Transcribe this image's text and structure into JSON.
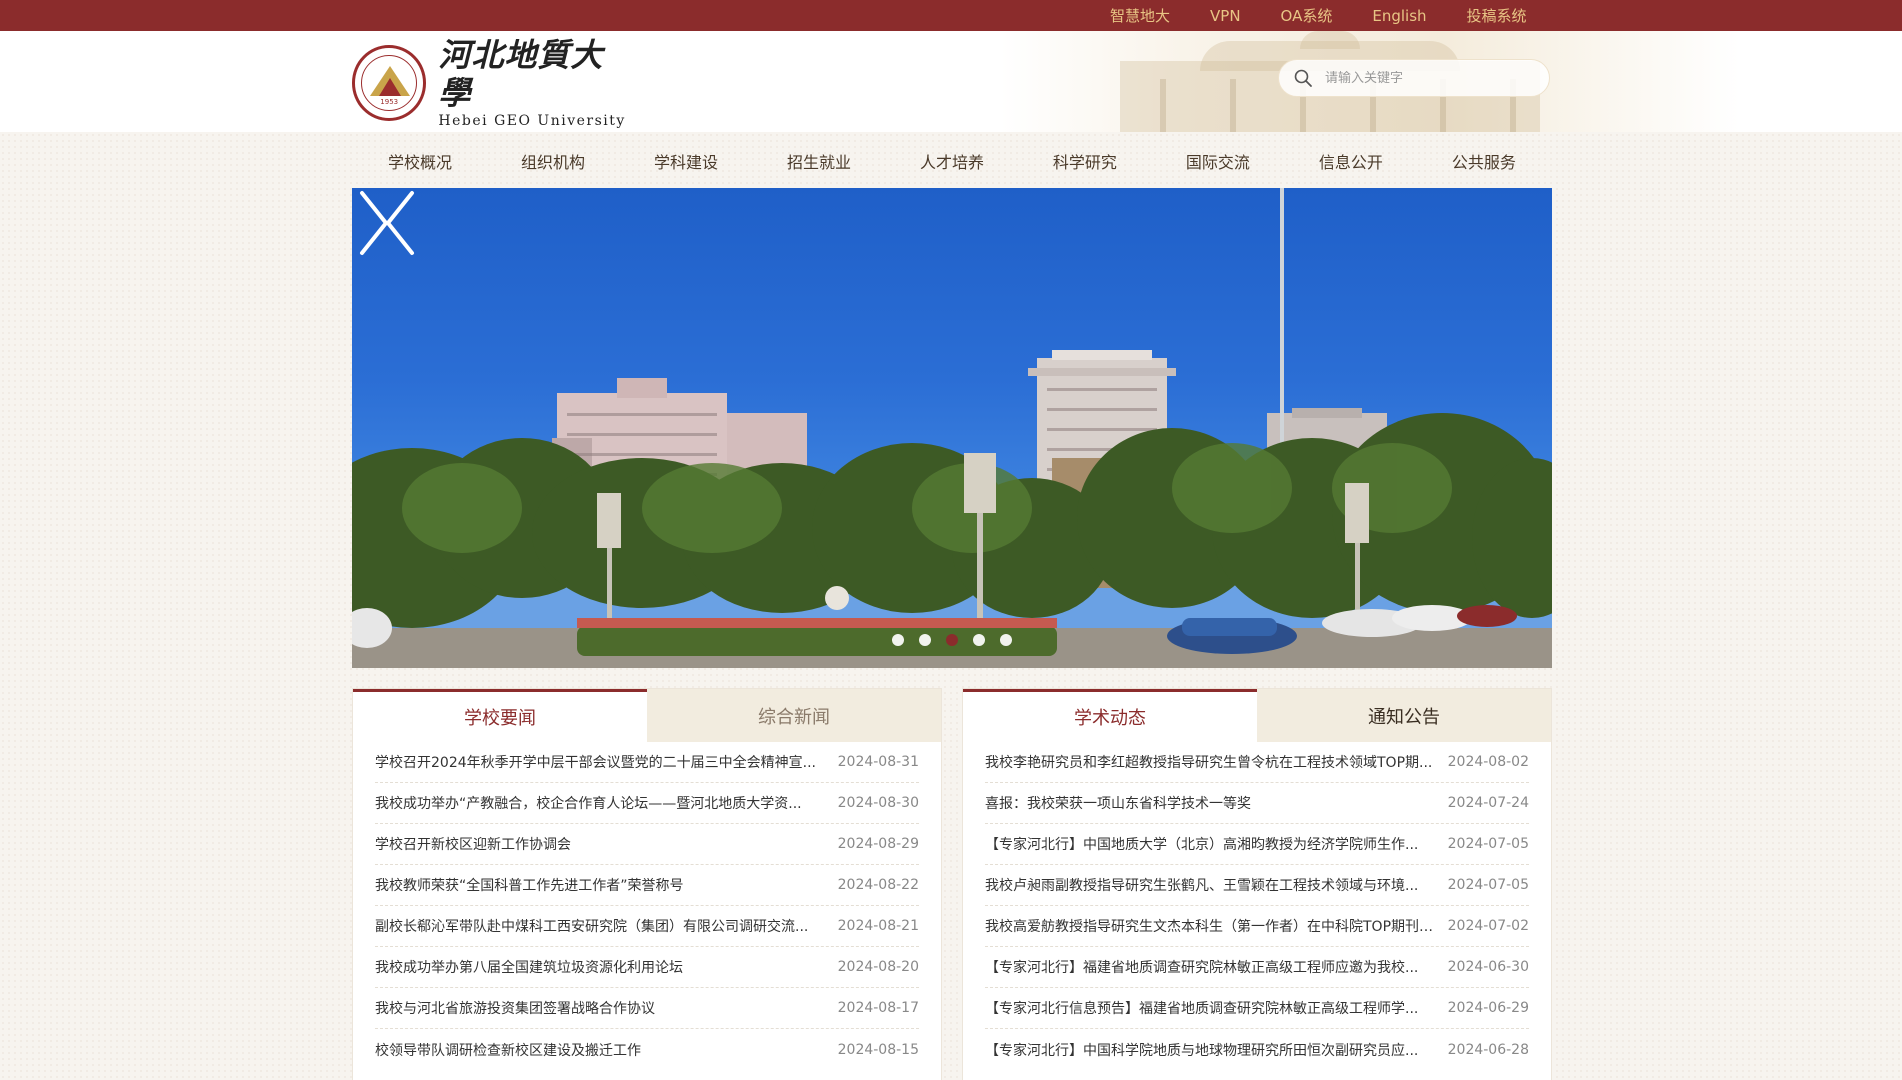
{
  "topbar": {
    "links": [
      "智慧地大",
      "VPN",
      "OA系统",
      "English",
      "投稿系统"
    ]
  },
  "header": {
    "logo_cn": "河北地質大學",
    "logo_en": "Hebei GEO University",
    "seal_year": "1953",
    "search_placeholder": "请输入关键字"
  },
  "nav": {
    "items": [
      "学校概况",
      "组织机构",
      "学科建设",
      "招生就业",
      "人才培养",
      "科学研究",
      "国际交流",
      "信息公开",
      "公共服务"
    ]
  },
  "banner": {
    "slide_count": 5,
    "active_slide": 3
  },
  "left_panel": {
    "tabs": [
      "学校要闻",
      "综合新闻"
    ],
    "active_tab": 0,
    "items": [
      {
        "title": "学校召开2024年秋季开学中层干部会议暨党的二十届三中全会精神宣...",
        "date": "2024-08-31"
      },
      {
        "title": "我校成功举办“产教融合，校企合作育人论坛——暨河北地质大学资...",
        "date": "2024-08-30"
      },
      {
        "title": "学校召开新校区迎新工作协调会",
        "date": "2024-08-29"
      },
      {
        "title": "我校教师荣获“全国科普工作先进工作者”荣誉称号",
        "date": "2024-08-22"
      },
      {
        "title": "副校长郗沁军带队赴中煤科工西安研究院（集团）有限公司调研交流...",
        "date": "2024-08-21"
      },
      {
        "title": "我校成功举办第八届全国建筑垃圾资源化利用论坛",
        "date": "2024-08-20"
      },
      {
        "title": "我校与河北省旅游投资集团签署战略合作协议",
        "date": "2024-08-17"
      },
      {
        "title": "校领导带队调研检查新校区建设及搬迁工作",
        "date": "2024-08-15"
      }
    ]
  },
  "right_panel": {
    "tabs": [
      "学术动态",
      "通知公告"
    ],
    "active_tab": 0,
    "items": [
      {
        "title": "我校李艳研究员和李红超教授指导研究生曾令杭在工程技术领域TOP期...",
        "date": "2024-08-02"
      },
      {
        "title": "喜报：我校荣获一项山东省科学技术一等奖",
        "date": "2024-07-24"
      },
      {
        "title": "【专家河北行】中国地质大学（北京）高湘昀教授为经济学院师生作...",
        "date": "2024-07-05"
      },
      {
        "title": "我校卢昶雨副教授指导研究生张鹤凡、王雪颖在工程技术领域与环境...",
        "date": "2024-07-05"
      },
      {
        "title": "我校高爱舫教授指导研究生文杰本科生（第一作者）在中科院TOP期刊Envi...",
        "date": "2024-07-02"
      },
      {
        "title": "【专家河北行】福建省地质调查研究院林敏正高级工程师应邀为我校...",
        "date": "2024-06-30"
      },
      {
        "title": "【专家河北行信息预告】福建省地质调查研究院林敏正高级工程师学...",
        "date": "2024-06-29"
      },
      {
        "title": "【专家河北行】中国科学院地质与地球物理研究所田恒次副研究员应...",
        "date": "2024-06-28"
      }
    ]
  },
  "colors": {
    "brand": "#8b2c2c",
    "topbar_link": "#e8c585",
    "inactive_tab_bg": "#f2ecdf"
  }
}
